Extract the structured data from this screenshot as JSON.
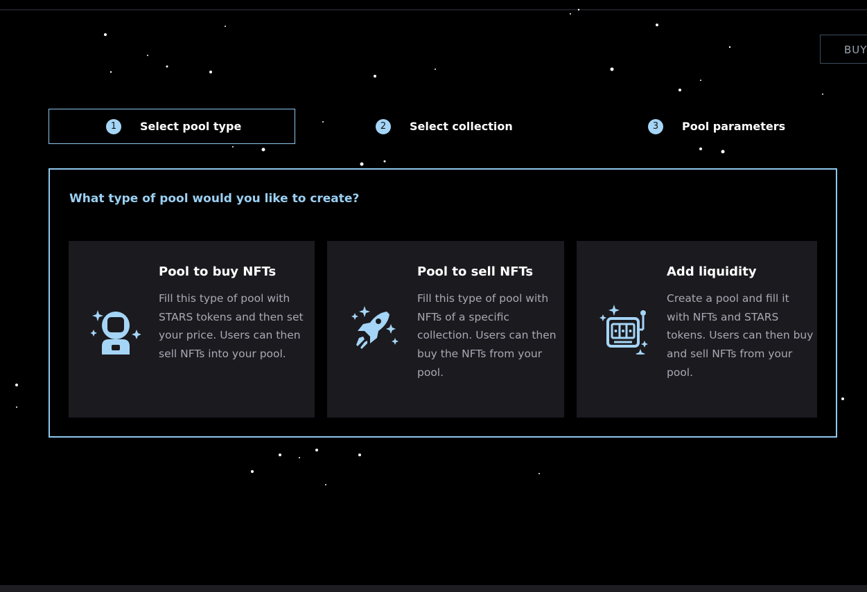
{
  "header": {
    "buy_label": "BUY"
  },
  "steps": [
    {
      "number": "1",
      "label": "Select pool type",
      "active": true
    },
    {
      "number": "2",
      "label": "Select collection",
      "active": false
    },
    {
      "number": "3",
      "label": "Pool parameters",
      "active": false
    }
  ],
  "question": "What type of pool would you like to create?",
  "cards": [
    {
      "title": "Pool to buy NFTs",
      "description": "Fill this type of pool with STARS tokens and then set your price. Users can then sell NFTs into your pool.",
      "icon": "astronaut-icon"
    },
    {
      "title": "Pool to sell NFTs",
      "description": "Fill this type of pool with NFTs of a specific collection. Users can then buy the NFTs from your pool.",
      "icon": "rocket-icon"
    },
    {
      "title": "Add liquidity",
      "description": "Create a pool and fill it with NFTs and STARS tokens. Users can then buy and sell NFTs from your pool.",
      "icon": "slot-machine-icon"
    }
  ],
  "colors": {
    "accent": "#8fc8ef",
    "icon": "#a5d5f6",
    "card_bg": "#1b1a1f",
    "background": "#000000"
  }
}
